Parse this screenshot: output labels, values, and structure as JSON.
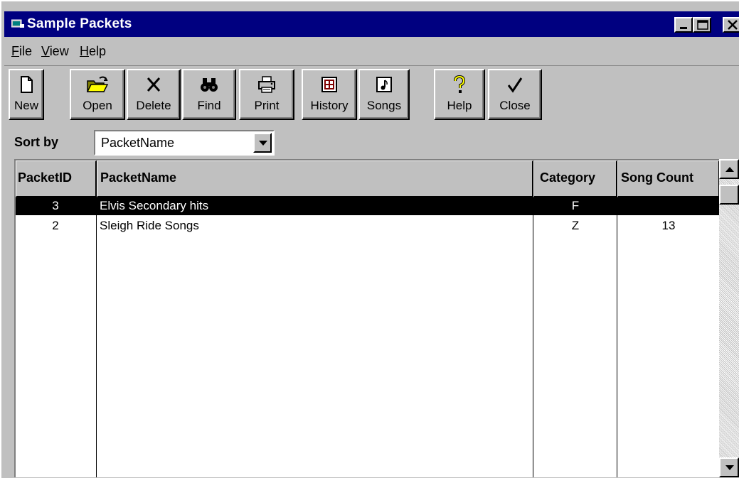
{
  "window": {
    "title": "Sample Packets",
    "icon": "app-window-icon"
  },
  "menu": [
    {
      "ul": "F",
      "rest": "ile"
    },
    {
      "ul": "V",
      "rest": "iew"
    },
    {
      "ul": "H",
      "rest": "elp"
    }
  ],
  "toolbar": [
    {
      "label": "New",
      "icon": "new-document-icon"
    },
    {
      "label": "Open",
      "icon": "open-folder-icon"
    },
    {
      "label": "Delete",
      "icon": "delete-x-icon"
    },
    {
      "label": "Find",
      "icon": "binoculars-icon"
    },
    {
      "label": "Print",
      "icon": "printer-icon"
    },
    {
      "label": "History",
      "icon": "history-icon"
    },
    {
      "label": "Songs",
      "icon": "music-note-icon"
    },
    {
      "label": "Help",
      "icon": "question-mark-icon"
    },
    {
      "label": "Close",
      "icon": "checkmark-icon"
    }
  ],
  "sort": {
    "label": "Sort by",
    "value": "PacketName"
  },
  "grid": {
    "columns": [
      "PacketID",
      "PacketName",
      "Category",
      "Song Count"
    ],
    "rows": [
      {
        "id": "3",
        "name": "Elvis Secondary hits",
        "category": "F",
        "count": "",
        "selected": true
      },
      {
        "id": "2",
        "name": "Sleigh Ride Songs",
        "category": "Z",
        "count": "13",
        "selected": false
      }
    ]
  },
  "colors": {
    "titlebar": "#000080",
    "face": "#c0c0c0",
    "selection": "#000000"
  }
}
